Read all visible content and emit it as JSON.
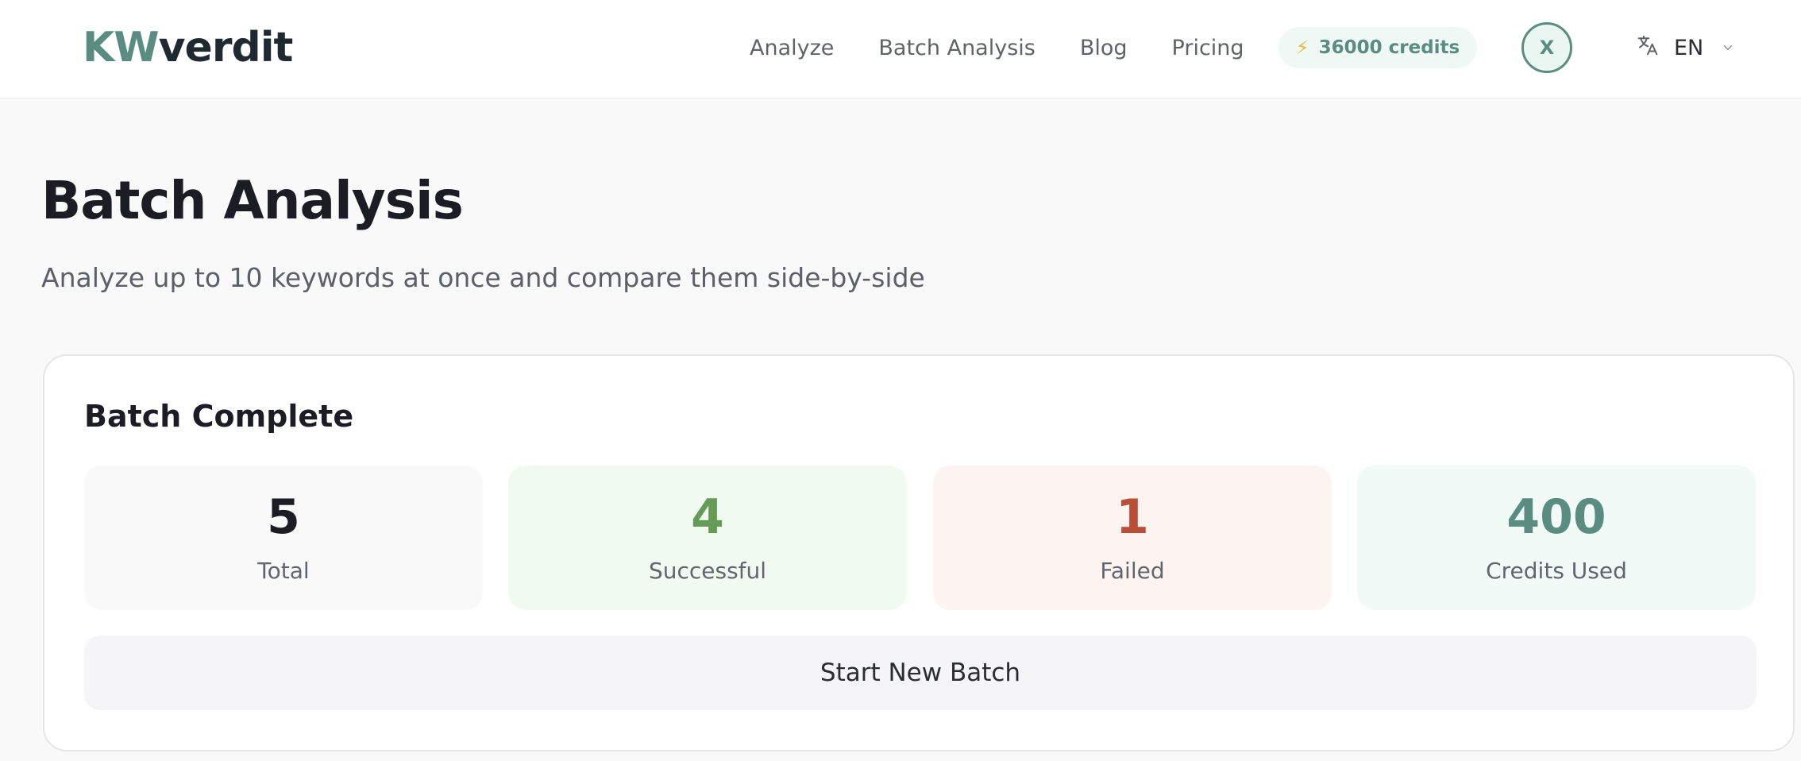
{
  "header": {
    "logo": {
      "part1": "KW",
      "part2": "verdit"
    },
    "nav": [
      {
        "label": "Analyze"
      },
      {
        "label": "Batch Analysis"
      },
      {
        "label": "Blog"
      },
      {
        "label": "Pricing"
      }
    ],
    "credits": {
      "icon": "lightning-bolt-icon",
      "label": "36000 credits"
    },
    "avatar": {
      "initial": "X"
    },
    "language": {
      "icon": "translate-icon",
      "code": "EN",
      "chevron": "chevron-down-icon"
    }
  },
  "page": {
    "title": "Batch Analysis",
    "subtitle": "Analyze up to 10 keywords at once and compare them side-by-side"
  },
  "batch": {
    "title": "Batch Complete",
    "stats": {
      "total": {
        "value": "5",
        "label": "Total"
      },
      "successful": {
        "value": "4",
        "label": "Successful"
      },
      "failed": {
        "value": "1",
        "label": "Failed"
      },
      "credits": {
        "value": "400",
        "label": "Credits Used"
      }
    },
    "new_batch_label": "Start New Batch"
  },
  "colors": {
    "brand": "#5a8d7f",
    "success": "#659a57",
    "failed": "#b84f36"
  }
}
